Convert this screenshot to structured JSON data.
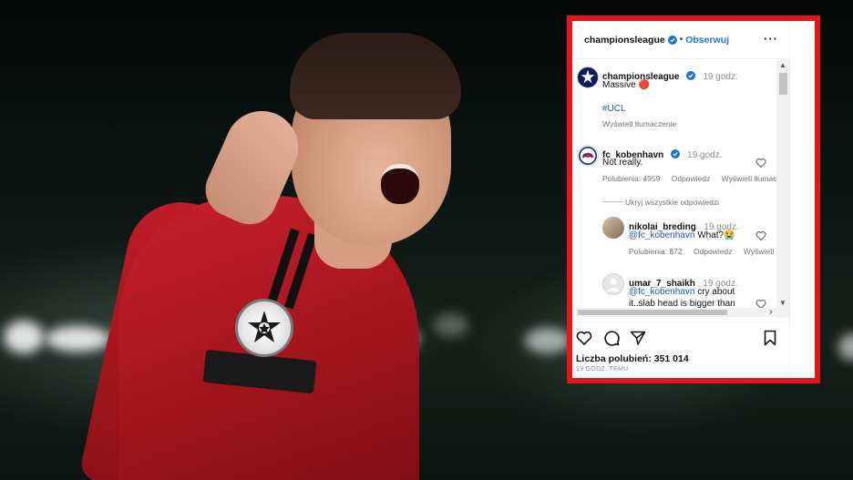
{
  "background": {
    "subject": "player-celebrating-photo",
    "accent_red": "#e4141b"
  },
  "post": {
    "author": "championsleague",
    "follow_label": "Obserwuj",
    "more_icon": "more-options-icon",
    "caption": {
      "author": "championsleague",
      "time": "19 godz.",
      "text": "Massive 🔴",
      "hashtag": "#UCL",
      "translate": "Wyświetl tłumaczenie"
    },
    "comments": [
      {
        "user": "fc_kobenhavn",
        "verified": true,
        "time": "19 godz.",
        "text": "Not really.",
        "likes": "Polubienia: 4959",
        "reply": "Odpowiedz",
        "translate": "Wyświetl tłumac",
        "hide_replies": "Ukryj wszystkie odpowiedzi"
      },
      {
        "user": "nikolai_breding",
        "time": "19 godz.",
        "mention": "@fc_kobenhavn",
        "text": "What?😭",
        "likes": "Polubienia: 872",
        "reply": "Odpowiedz",
        "translate": "Wyświetl t"
      },
      {
        "user": "umar_7_shaikh",
        "time": "19 godz.",
        "mention": "@fc_kobenhavn",
        "text_line1": "cry about",
        "text_line2": "it..slab head is bigger than"
      }
    ],
    "likes_total": "Liczba polubień: 351 014",
    "posted_ago": "19 GODZ. TEMU"
  }
}
